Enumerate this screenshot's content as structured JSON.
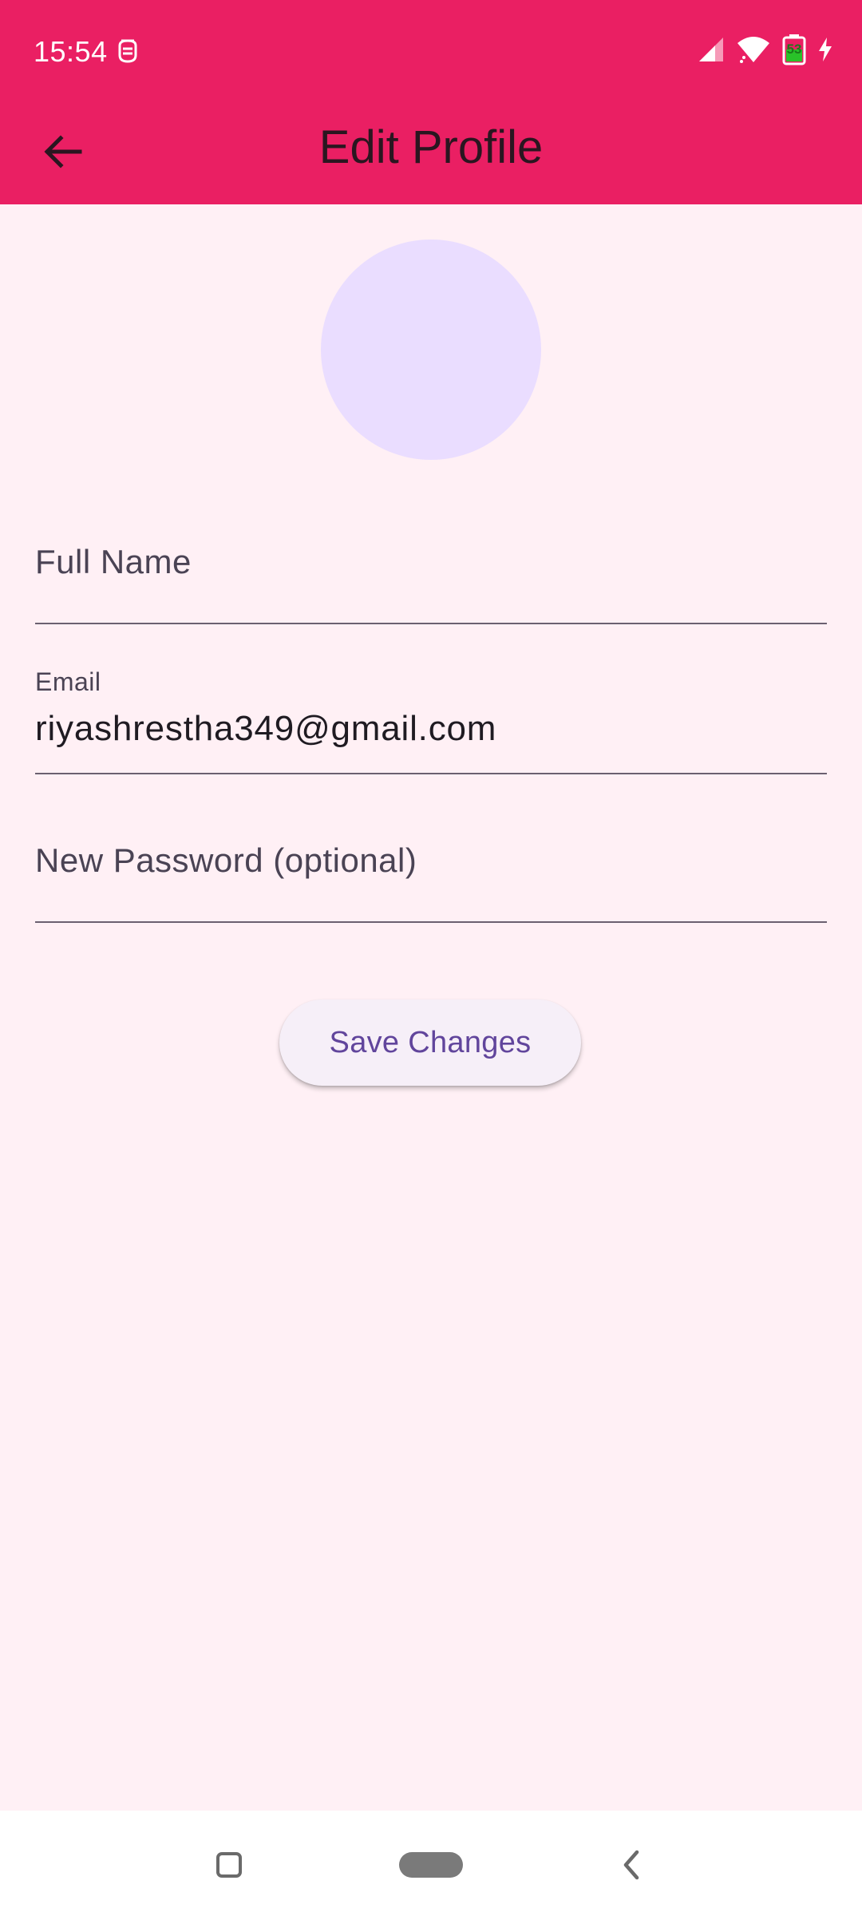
{
  "status_bar": {
    "time": "15:54",
    "icons": [
      "notification-icon",
      "signal-icon",
      "wifi-icon",
      "battery-icon",
      "charging-icon"
    ],
    "battery_level": "53"
  },
  "app_bar": {
    "title": "Edit Profile",
    "back_icon": "arrow-back-icon"
  },
  "avatar": {
    "color": "#EADDFF"
  },
  "form": {
    "full_name": {
      "label": "Full Name",
      "value": ""
    },
    "email": {
      "label": "Email",
      "value": "riyashrestha349@gmail.com"
    },
    "new_password": {
      "label": "New Password (optional)",
      "value": ""
    }
  },
  "save_button": {
    "label": "Save Changes"
  },
  "nav_bar": {
    "items": [
      "recents-icon",
      "home-pill-icon",
      "back-chevron-icon"
    ]
  },
  "colors": {
    "accent": "#EA1F63",
    "background": "#FFF0F5",
    "button_text": "#61459C"
  }
}
